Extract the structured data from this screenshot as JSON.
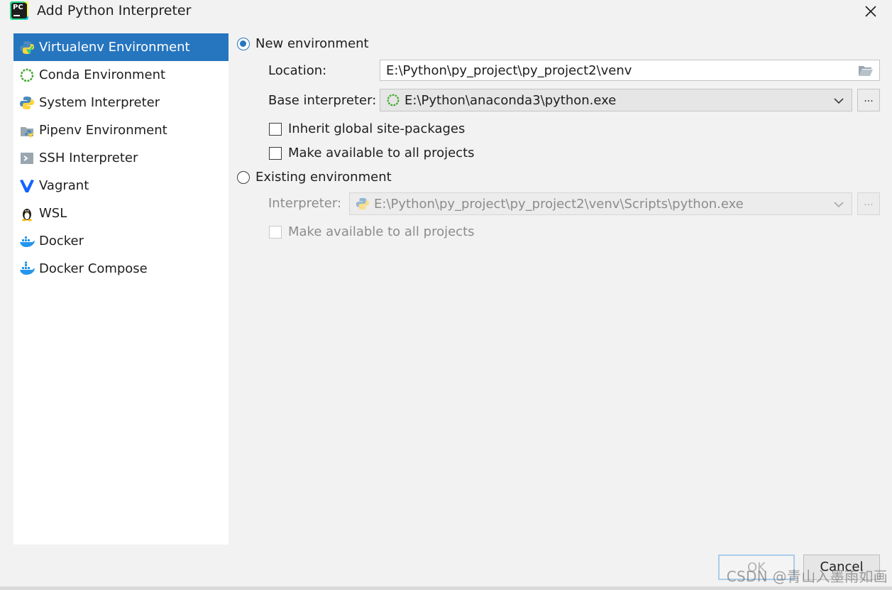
{
  "window": {
    "title": "Add Python Interpreter"
  },
  "sidebar": {
    "items": [
      {
        "label": "Virtualenv Environment",
        "icon": "virtualenv-icon",
        "selected": true
      },
      {
        "label": "Conda Environment",
        "icon": "conda-icon"
      },
      {
        "label": "System Interpreter",
        "icon": "python-icon"
      },
      {
        "label": "Pipenv Environment",
        "icon": "pipenv-icon"
      },
      {
        "label": "SSH Interpreter",
        "icon": "ssh-icon"
      },
      {
        "label": "Vagrant",
        "icon": "vagrant-icon"
      },
      {
        "label": "WSL",
        "icon": "linux-icon"
      },
      {
        "label": "Docker",
        "icon": "docker-icon"
      },
      {
        "label": "Docker Compose",
        "icon": "docker-icon"
      }
    ]
  },
  "new_env": {
    "radio_label": "New environment",
    "checked": true,
    "location_label": "Location:",
    "location_value": "E:\\Python\\py_project\\py_project2\\venv",
    "base_label": "Base interpreter:",
    "base_value": "E:\\Python\\anaconda3\\python.exe",
    "browse_label": "...",
    "inherit_label": "Inherit global site-packages",
    "make_available_label": "Make available to all projects"
  },
  "existing_env": {
    "radio_label": "Existing environment",
    "checked": false,
    "interpreter_label": "Interpreter:",
    "interpreter_value": "E:\\Python\\py_project\\py_project2\\venv\\Scripts\\python.exe",
    "browse_label": "...",
    "make_available_label": "Make available to all projects"
  },
  "buttons": {
    "ok": "OK",
    "cancel": "Cancel"
  },
  "watermark": "CSDN @青山入墨雨如画",
  "colors": {
    "accent": "#2675bf",
    "selection": "#2675bf"
  }
}
